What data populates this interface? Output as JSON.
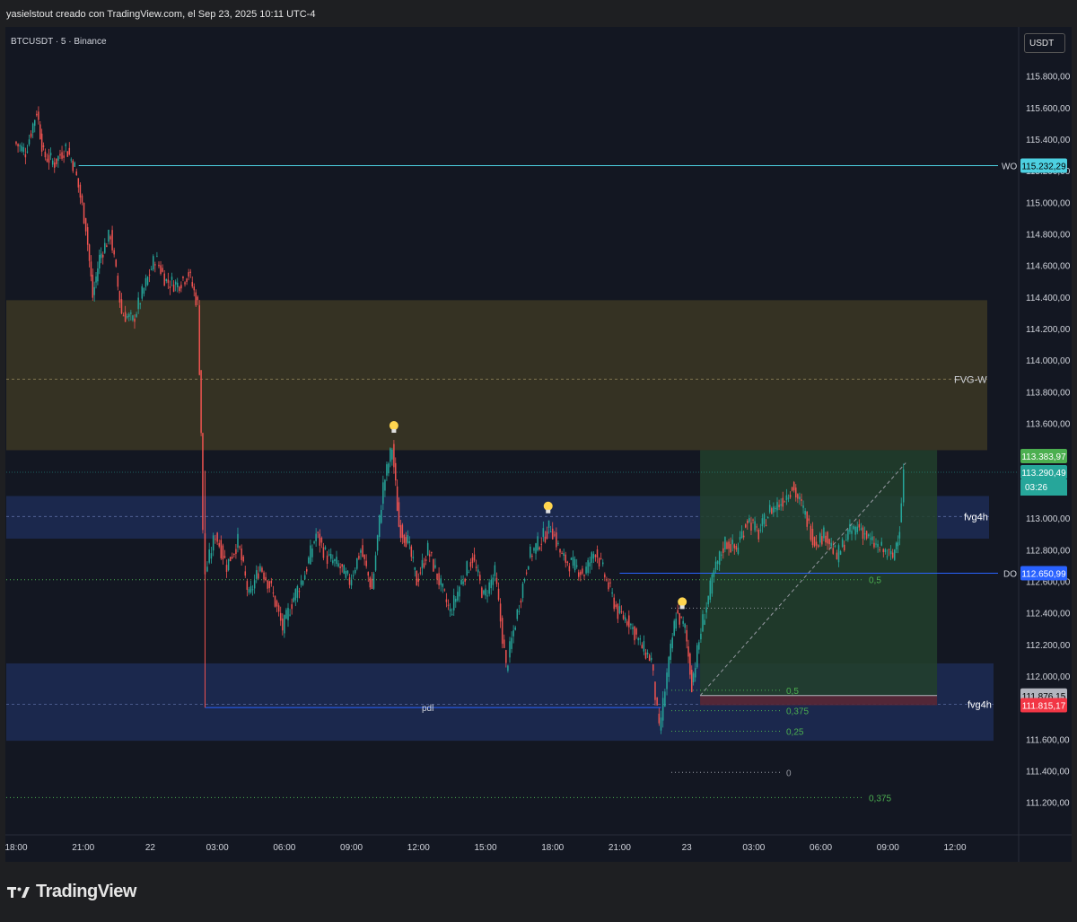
{
  "header": {
    "caption": "yasielstout creado con TradingView.com, el Sep 23, 2025 10:11 UTC-4"
  },
  "symbol_line": "BTCUSDT · 5 · Binance",
  "currency_badge": "USDT",
  "logo_text": "TradingView",
  "colors": {
    "background": "#131722",
    "up": "#26a69a",
    "down": "#ef5350",
    "wo_line": "#4dd0e1",
    "do_line": "#2962ff",
    "fvg_weekly": "#3a3523",
    "fvg_4h": "#1d2a52",
    "position_zone": "#22402b",
    "fib": "#4caf50"
  },
  "chart_data": {
    "type": "candlestick",
    "symbol": "BTCUSDT",
    "interval": "5",
    "exchange": "Binance",
    "ylim": [
      111100,
      115950
    ],
    "y_ticks": [
      {
        "value": 115800,
        "label": "115.800,00"
      },
      {
        "value": 115600,
        "label": "115.600,00"
      },
      {
        "value": 115400,
        "label": "115.400,00"
      },
      {
        "value": 115200,
        "label": "115.200,00"
      },
      {
        "value": 115000,
        "label": "115.000,00"
      },
      {
        "value": 114800,
        "label": "114.800,00"
      },
      {
        "value": 114600,
        "label": "114.600,00"
      },
      {
        "value": 114400,
        "label": "114.400,00"
      },
      {
        "value": 114200,
        "label": "114.200,00"
      },
      {
        "value": 114000,
        "label": "114.000,00"
      },
      {
        "value": 113800,
        "label": "113.800,00"
      },
      {
        "value": 113600,
        "label": "113.600,00"
      },
      {
        "value": 113000,
        "label": "113.000,00"
      },
      {
        "value": 112800,
        "label": "112.800,00"
      },
      {
        "value": 112600,
        "label": "112.600,00"
      },
      {
        "value": 112400,
        "label": "112.400,00"
      },
      {
        "value": 112200,
        "label": "112.200,00"
      },
      {
        "value": 112000,
        "label": "112.000,00"
      },
      {
        "value": 111600,
        "label": "111.600,00"
      },
      {
        "value": 111400,
        "label": "111.400,00"
      },
      {
        "value": 111200,
        "label": "111.200,00"
      }
    ],
    "x_ticks": [
      {
        "hours": 0,
        "label": "18:00"
      },
      {
        "hours": 3,
        "label": "21:00"
      },
      {
        "hours": 6,
        "label": "22"
      },
      {
        "hours": 9,
        "label": "03:00"
      },
      {
        "hours": 12,
        "label": "06:00"
      },
      {
        "hours": 15,
        "label": "09:00"
      },
      {
        "hours": 18,
        "label": "12:00"
      },
      {
        "hours": 21,
        "label": "15:00"
      },
      {
        "hours": 24,
        "label": "18:00"
      },
      {
        "hours": 27,
        "label": "21:00"
      },
      {
        "hours": 30,
        "label": "23"
      },
      {
        "hours": 33,
        "label": "03:00"
      },
      {
        "hours": 36,
        "label": "06:00"
      },
      {
        "hours": 39,
        "label": "09:00"
      },
      {
        "hours": 42,
        "label": "12:00"
      }
    ],
    "xlim_hours": [
      -0.3,
      44.8
    ],
    "price_path": [
      [
        0,
        115380
      ],
      [
        0.5,
        115320
      ],
      [
        1.0,
        115580
      ],
      [
        1.3,
        115300
      ],
      [
        1.8,
        115250
      ],
      [
        2.3,
        115350
      ],
      [
        2.7,
        115220
      ],
      [
        3.2,
        114850
      ],
      [
        3.5,
        114400
      ],
      [
        3.8,
        114650
      ],
      [
        4.3,
        114800
      ],
      [
        4.8,
        114300
      ],
      [
        5.3,
        114250
      ],
      [
        5.8,
        114450
      ],
      [
        6.3,
        114650
      ],
      [
        6.8,
        114500
      ],
      [
        7.3,
        114480
      ],
      [
        7.8,
        114550
      ],
      [
        8.2,
        114350
      ],
      [
        8.35,
        113550
      ],
      [
        8.45,
        112900
      ],
      [
        8.55,
        112650
      ],
      [
        9.0,
        112900
      ],
      [
        9.5,
        112700
      ],
      [
        10.0,
        112850
      ],
      [
        10.5,
        112500
      ],
      [
        11.0,
        112700
      ],
      [
        11.5,
        112550
      ],
      [
        12.0,
        112300
      ],
      [
        12.5,
        112500
      ],
      [
        13.0,
        112650
      ],
      [
        13.5,
        112900
      ],
      [
        14.0,
        112750
      ],
      [
        14.5,
        112700
      ],
      [
        15.0,
        112600
      ],
      [
        15.5,
        112800
      ],
      [
        16.0,
        112550
      ],
      [
        16.5,
        113200
      ],
      [
        16.9,
        113450
      ],
      [
        17.2,
        112950
      ],
      [
        17.6,
        112850
      ],
      [
        18.0,
        112600
      ],
      [
        18.5,
        112800
      ],
      [
        19.0,
        112600
      ],
      [
        19.5,
        112400
      ],
      [
        20.0,
        112600
      ],
      [
        20.5,
        112750
      ],
      [
        21.0,
        112500
      ],
      [
        21.5,
        112650
      ],
      [
        22.0,
        112050
      ],
      [
        22.5,
        112400
      ],
      [
        23.0,
        112750
      ],
      [
        23.5,
        112850
      ],
      [
        24.0,
        112950
      ],
      [
        24.5,
        112750
      ],
      [
        25.0,
        112700
      ],
      [
        25.5,
        112650
      ],
      [
        26.0,
        112800
      ],
      [
        26.5,
        112600
      ],
      [
        27.0,
        112400
      ],
      [
        27.5,
        112350
      ],
      [
        28.0,
        112200
      ],
      [
        28.5,
        112100
      ],
      [
        28.85,
        111650
      ],
      [
        29.2,
        112000
      ],
      [
        29.6,
        112400
      ],
      [
        30.0,
        112300
      ],
      [
        30.3,
        111950
      ],
      [
        30.8,
        112350
      ],
      [
        31.3,
        112650
      ],
      [
        31.8,
        112850
      ],
      [
        32.3,
        112800
      ],
      [
        32.8,
        113000
      ],
      [
        33.3,
        112900
      ],
      [
        33.8,
        113050
      ],
      [
        34.3,
        113100
      ],
      [
        34.8,
        113200
      ],
      [
        35.3,
        113050
      ],
      [
        35.8,
        112850
      ],
      [
        36.3,
        112900
      ],
      [
        36.8,
        112750
      ],
      [
        37.3,
        112900
      ],
      [
        37.8,
        112950
      ],
      [
        38.3,
        112850
      ],
      [
        38.8,
        112800
      ],
      [
        39.3,
        112750
      ],
      [
        39.6,
        112950
      ],
      [
        39.8,
        113290
      ]
    ],
    "current_time_label": "03:26",
    "price_labels": [
      {
        "value": 115232.29,
        "label": "115.232,29",
        "color": "#4dd0e1",
        "text_color": "#000000"
      },
      {
        "value": 113383.97,
        "label": "113.383,97",
        "color": "#4caf50",
        "text_color": "#ffffff"
      },
      {
        "value": 113290.49,
        "label": "113.290,49",
        "color": "#26a69a",
        "text_color": "#ffffff"
      },
      {
        "value": 112650.99,
        "label": "112.650,99",
        "color": "#2962ff",
        "text_color": "#ffffff"
      },
      {
        "value": 111876.15,
        "label": "111.876,15",
        "color": "#b2b5be",
        "text_color": "#000000"
      },
      {
        "value": 111815.17,
        "label": "111.815,17",
        "color": "#f23645",
        "text_color": "#ffffff"
      }
    ],
    "annotations": {
      "wo": {
        "label": "WO",
        "price": 115232.29,
        "from_hours": 2.8
      },
      "fvg_w": {
        "label": "FVG-W",
        "top": 114380,
        "bottom": 113430,
        "mid": 113880
      },
      "fvg4h_upper": {
        "label": "fvg4h",
        "top": 113140,
        "bottom": 112870,
        "mid": 113010
      },
      "fvg4h_lower": {
        "label": "fvg4h",
        "top": 112080,
        "bottom": 111590,
        "mid": 111820
      },
      "do": {
        "label": "DO",
        "price": 112650.99,
        "from_hours": 27.0
      },
      "pdl": {
        "label": "pdl",
        "price": 111800,
        "from_hours": 8.45,
        "to_hours": 28.85
      },
      "position": {
        "entry": 111876.15,
        "stop": 111815.17,
        "target": 113430,
        "from_hours": 30.6,
        "to_hours": 41.2
      },
      "fib_levels": [
        {
          "label": "0,5",
          "price": 111910
        },
        {
          "label": "0,375",
          "price": 111780
        },
        {
          "label": "0,25",
          "price": 111650
        },
        {
          "label": "0",
          "price": 111390
        }
      ],
      "fib_levels_outer": [
        {
          "label": "0,5",
          "price": 112610
        },
        {
          "label": "0,375",
          "price": 111230
        }
      ],
      "current_price": 113290.49,
      "ideas_hours": [
        16.9,
        23.8,
        29.8
      ]
    }
  }
}
